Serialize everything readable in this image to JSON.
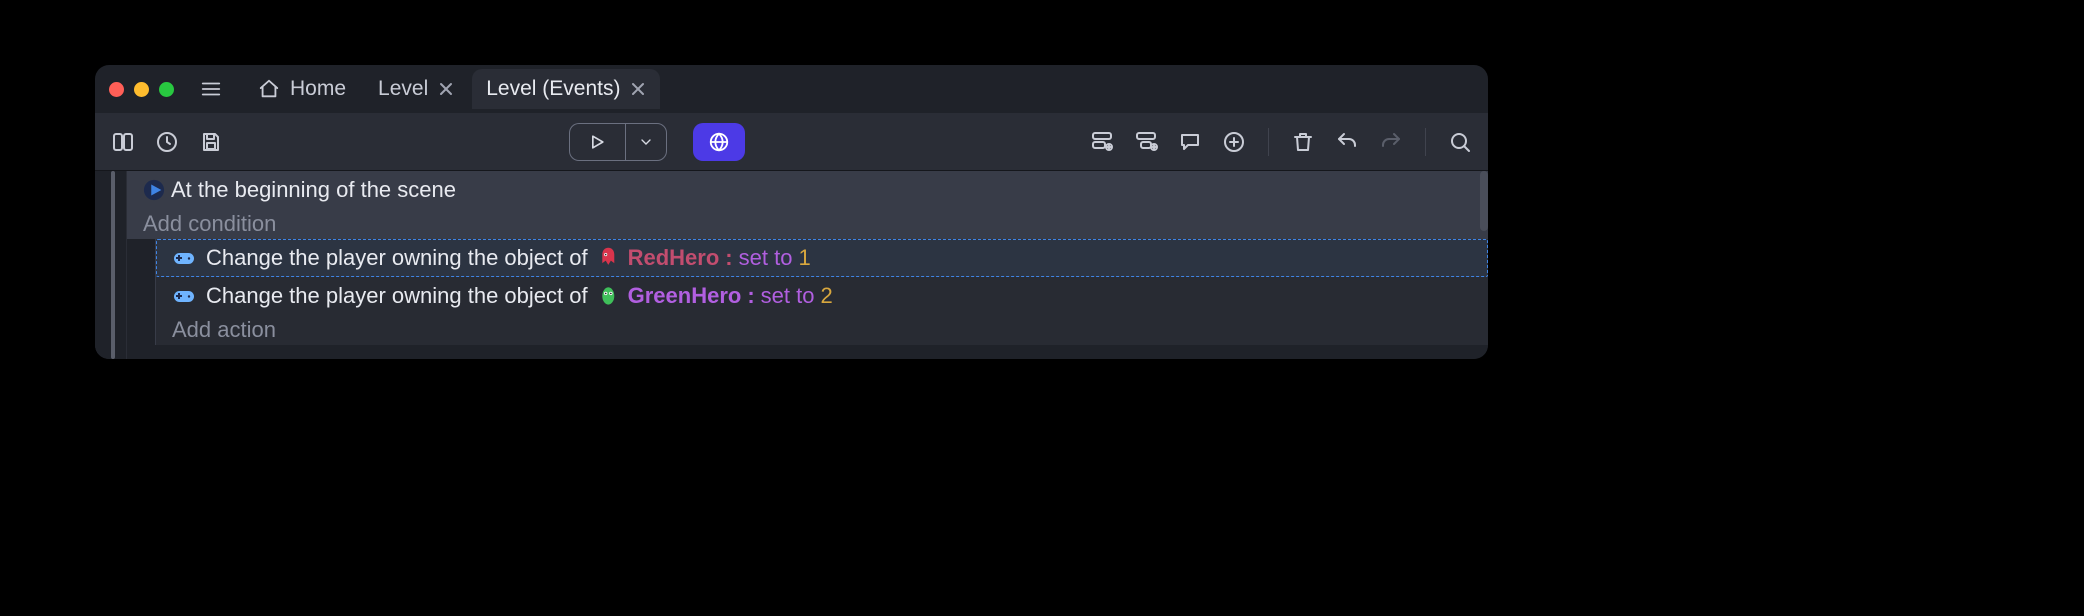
{
  "titlebar": {
    "tabs": [
      {
        "label": "Home",
        "has_icon": true,
        "closable": false
      },
      {
        "label": "Level",
        "has_icon": false,
        "closable": true
      },
      {
        "label": "Level (Events)",
        "has_icon": false,
        "closable": true,
        "active": true
      }
    ]
  },
  "event": {
    "condition_prefix": "At the beginning of the scene",
    "add_condition": "Add condition",
    "add_action": "Add action",
    "actions": [
      {
        "prefix": "Change the player owning the object of ",
        "object": "RedHero",
        "op_label": "set to",
        "value": "1",
        "sprite": "red"
      },
      {
        "prefix": "Change the player owning the object of ",
        "object": "GreenHero",
        "op_label": "set to",
        "value": "2",
        "sprite": "green"
      }
    ]
  }
}
